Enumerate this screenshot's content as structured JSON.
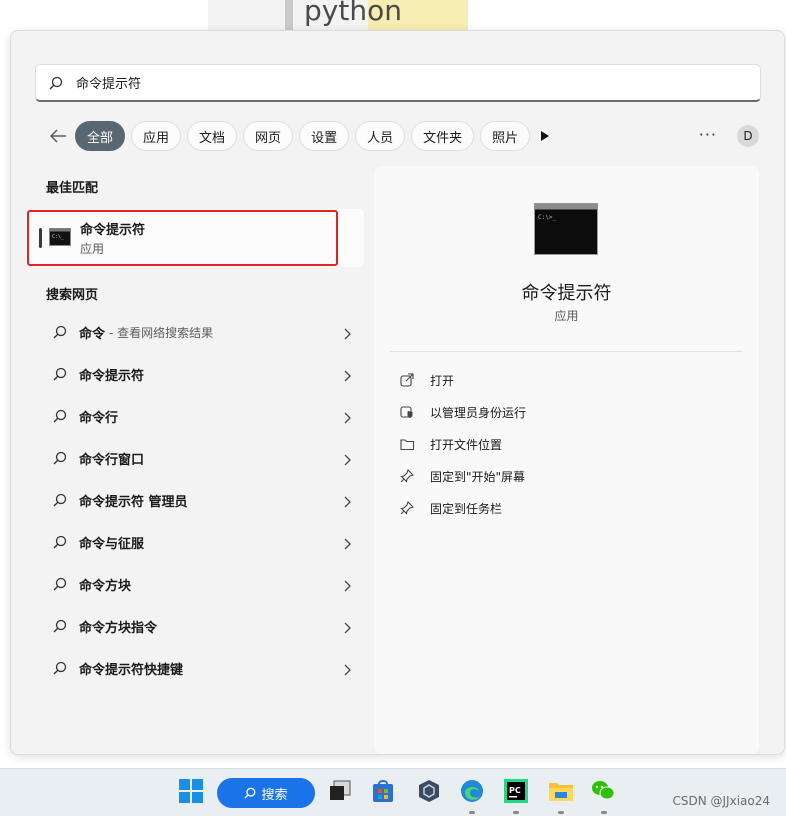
{
  "background_window": {
    "text": "python"
  },
  "search": {
    "value": "命令提示符",
    "placeholder": ""
  },
  "filters": {
    "tabs": [
      {
        "label": "全部",
        "active": true
      },
      {
        "label": "应用",
        "active": false
      },
      {
        "label": "文档",
        "active": false
      },
      {
        "label": "网页",
        "active": false
      },
      {
        "label": "设置",
        "active": false
      },
      {
        "label": "人员",
        "active": false
      },
      {
        "label": "文件夹",
        "active": false
      },
      {
        "label": "照片",
        "active": false
      }
    ],
    "more_label": "···",
    "avatar_initial": "D"
  },
  "best_match": {
    "title": "最佳匹配",
    "name": "命令提示符",
    "type": "应用"
  },
  "web_search": {
    "title": "搜索网页",
    "items": [
      {
        "label": "命令",
        "sub": "- 查看网络搜索结果"
      },
      {
        "label": "命令提示符",
        "sub": ""
      },
      {
        "label": "命令行",
        "sub": ""
      },
      {
        "label": "命令行窗口",
        "sub": ""
      },
      {
        "label": "命令提示符 管理员",
        "sub": ""
      },
      {
        "label": "命令与征服",
        "sub": ""
      },
      {
        "label": "命令方块",
        "sub": ""
      },
      {
        "label": "命令方块指令",
        "sub": ""
      },
      {
        "label": "命令提示符快捷键",
        "sub": ""
      }
    ]
  },
  "detail": {
    "name": "命令提示符",
    "type": "应用",
    "actions": [
      {
        "label": "打开",
        "icon": "open-external-icon"
      },
      {
        "label": "以管理员身份运行",
        "icon": "shield-icon"
      },
      {
        "label": "打开文件位置",
        "icon": "folder-icon"
      },
      {
        "label": "固定到\"开始\"屏幕",
        "icon": "pin-icon"
      },
      {
        "label": "固定到任务栏",
        "icon": "pin-icon"
      }
    ]
  },
  "taskbar": {
    "search_label": "搜索",
    "watermark": "CSDN @JJxiao24"
  },
  "colors": {
    "accent": "#1a73e8",
    "highlight_box": "#e02323",
    "chip_active": "#5b6770"
  }
}
